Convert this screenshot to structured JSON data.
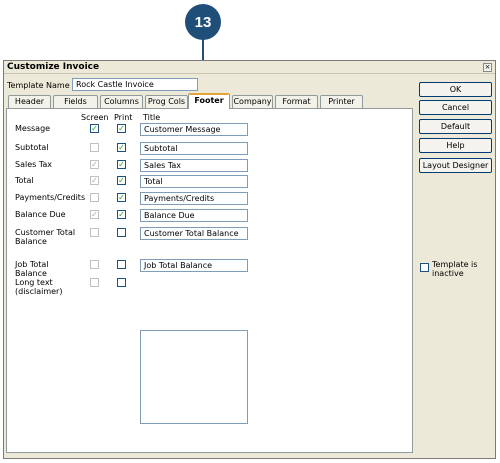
{
  "callout": {
    "number": "13"
  },
  "window": {
    "title": "Customize Invoice",
    "close_glyph": "×"
  },
  "template": {
    "label": "Template Name",
    "value": "Rock Castle Invoice"
  },
  "tabs": [
    "Header",
    "Fields",
    "Columns",
    "Prog Cols",
    "Footer",
    "Company",
    "Format",
    "Printer"
  ],
  "active_tab": "Footer",
  "columns": {
    "screen": "Screen",
    "print": "Print",
    "title": "Title"
  },
  "rows": [
    {
      "label": "Message",
      "screen": true,
      "screen_disabled": false,
      "print": true,
      "title": "Customer Message"
    },
    {
      "label": "Subtotal",
      "screen": false,
      "screen_disabled": true,
      "print": true,
      "title": "Subtotal"
    },
    {
      "label": "Sales Tax",
      "screen": true,
      "screen_disabled": true,
      "print": true,
      "title": "Sales Tax"
    },
    {
      "label": "Total",
      "screen": true,
      "screen_disabled": true,
      "print": true,
      "title": "Total"
    },
    {
      "label": "Payments/Credits",
      "screen": false,
      "screen_disabled": true,
      "print": true,
      "title": "Payments/Credits"
    },
    {
      "label": "Balance Due",
      "screen": true,
      "screen_disabled": true,
      "print": true,
      "title": "Balance Due"
    },
    {
      "label": "Customer Total Balance",
      "screen": false,
      "screen_disabled": true,
      "print": false,
      "title": "Customer Total Balance"
    },
    {
      "label": "Job Total Balance",
      "screen": false,
      "screen_disabled": true,
      "print": false,
      "title": "Job Total Balance"
    },
    {
      "label": "Long text (disclaimer)",
      "screen": false,
      "screen_disabled": true,
      "print": false,
      "title": ""
    }
  ],
  "buttons": {
    "ok": "OK",
    "cancel": "Cancel",
    "default": "Default",
    "help": "Help",
    "layout_designer": "Layout Designer"
  },
  "inactive": {
    "label": "Template is inactive",
    "checked": false
  },
  "check_glyph": "✓"
}
